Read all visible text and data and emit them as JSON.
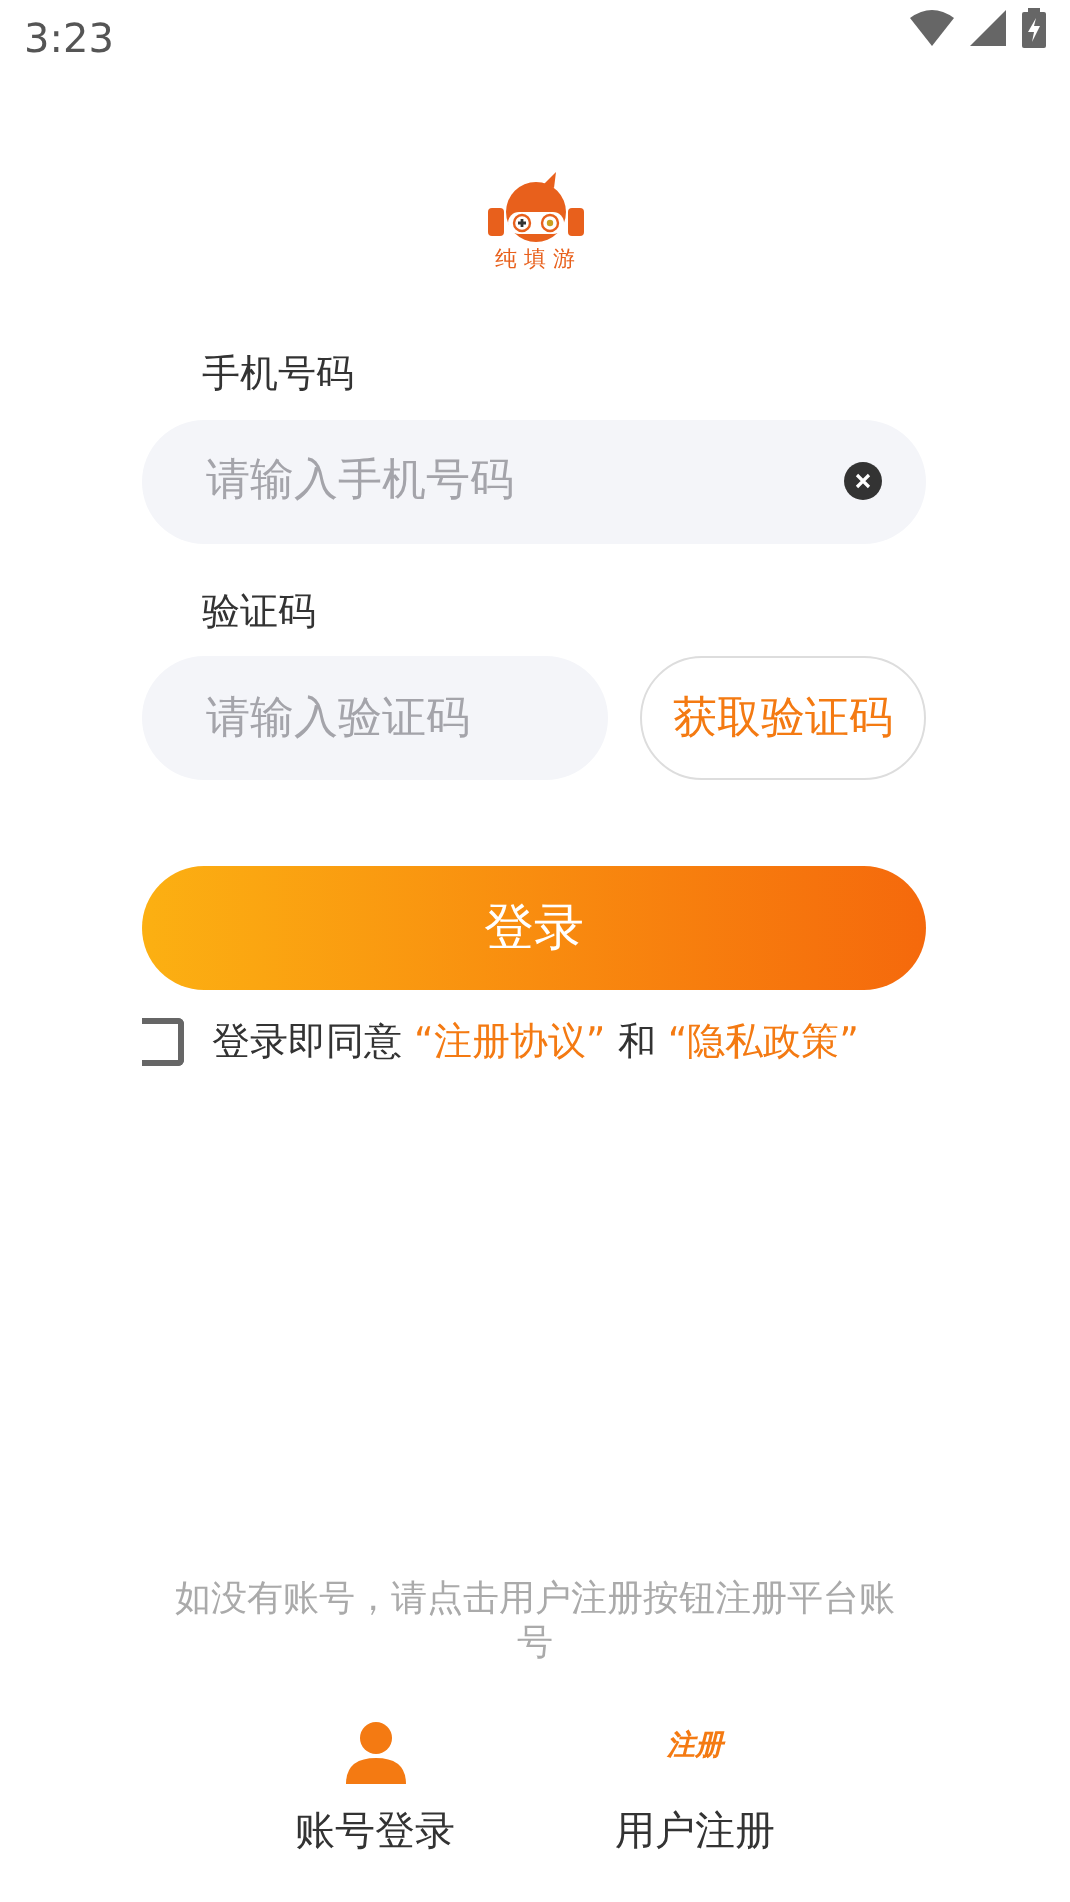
{
  "status_bar": {
    "time": "3:23"
  },
  "logo": {
    "text": "纯 填 游"
  },
  "form": {
    "phone": {
      "label": "手机号码",
      "placeholder": "请输入手机号码"
    },
    "code": {
      "label": "验证码",
      "placeholder": "请输入验证码",
      "button": "获取验证码"
    },
    "login_button": "登录",
    "agreement": {
      "checked": false,
      "parts": [
        {
          "kind": "plain",
          "text": "登录即同意 "
        },
        {
          "kind": "link",
          "text": "“注册协议”"
        },
        {
          "kind": "plain",
          "text": " 和 "
        },
        {
          "kind": "link",
          "text": "“隐私政策”"
        }
      ]
    }
  },
  "hint": "如没有账号，请点击用户注册按钮注册平台账号",
  "bottom_tabs": [
    {
      "kind": "person",
      "label": "账号登录"
    },
    {
      "kind": "text-icon",
      "icon_text": "注册",
      "label": "用户注册"
    }
  ]
}
